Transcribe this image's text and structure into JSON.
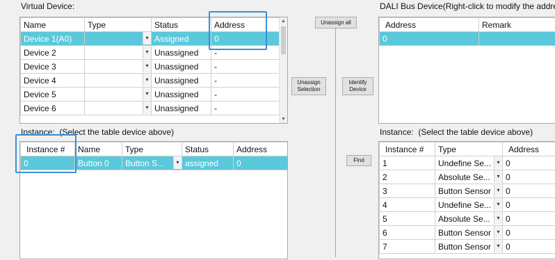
{
  "virtual_device": {
    "label": "Virtual Device:",
    "columns": [
      "Name",
      "Type",
      "Status",
      "Address"
    ],
    "rows": [
      {
        "name": "Device 1(A0)",
        "type": "",
        "status": "Assigned",
        "address": "0"
      },
      {
        "name": "Device 2",
        "type": "",
        "status": "Unassigned",
        "address": "-"
      },
      {
        "name": "Device 3",
        "type": "",
        "status": "Unassigned",
        "address": "-"
      },
      {
        "name": "Device 4",
        "type": "",
        "status": "Unassigned",
        "address": "-"
      },
      {
        "name": "Device 5",
        "type": "",
        "status": "Unassigned",
        "address": "-"
      },
      {
        "name": "Device 6",
        "type": "",
        "status": "Unassigned",
        "address": "-"
      }
    ]
  },
  "left_instance": {
    "label_prefix": "Instance:",
    "label_hint": "(Select the table device above)",
    "columns": [
      "Instance #",
      "Name",
      "Type",
      "Status",
      "Address"
    ],
    "rows": [
      {
        "instance": "0",
        "name": "Button 0",
        "type": "Button S...",
        "status": "assigned",
        "address": "0"
      }
    ]
  },
  "buttons": {
    "unassign_all": "Unassign all",
    "unassign_selection": "Unassign Selection",
    "identify_device": "Identify Device",
    "find": "Find"
  },
  "dali_bus": {
    "label": "DALI Bus Device(Right-click to modify the address)",
    "columns": [
      "Address",
      "Remark"
    ],
    "rows": [
      {
        "address": "0",
        "remark": ""
      }
    ]
  },
  "right_instance": {
    "label_prefix": "Instance:",
    "label_hint": "(Select the table device above)",
    "columns": [
      "Instance #",
      "Type",
      "Address"
    ],
    "rows": [
      {
        "instance": "1",
        "type": "Undefine Se...",
        "address": "0"
      },
      {
        "instance": "2",
        "type": "Absolute Se...",
        "address": "0"
      },
      {
        "instance": "3",
        "type": "Button Sensor",
        "address": "0"
      },
      {
        "instance": "4",
        "type": "Undefine Se...",
        "address": "0"
      },
      {
        "instance": "5",
        "type": "Absolute Se...",
        "address": "0"
      },
      {
        "instance": "6",
        "type": "Button Sensor",
        "address": "0"
      },
      {
        "instance": "7",
        "type": "Button Sensor",
        "address": "0"
      }
    ]
  },
  "icons": {
    "dropdown": "▾",
    "scroll_up": "▲",
    "scroll_down": "▼"
  },
  "colors": {
    "selection": "#5bc8db",
    "highlight_box": "#3b8edb"
  }
}
